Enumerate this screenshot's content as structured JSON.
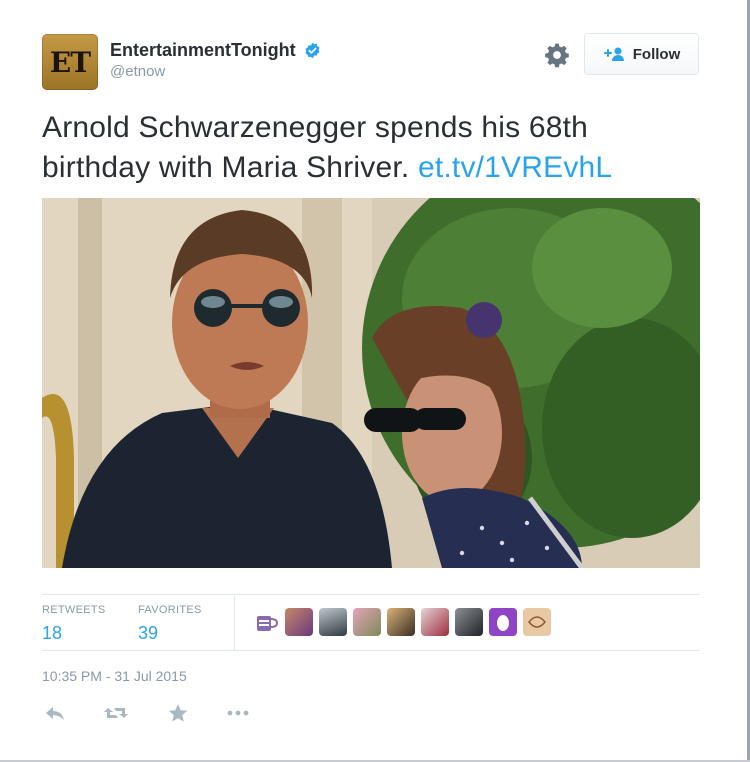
{
  "user": {
    "avatar_text": "ET",
    "fullname": "EntertainmentTonight",
    "handle": "@etnow"
  },
  "follow_button": {
    "label": "Follow"
  },
  "tweet": {
    "text": "Arnold Schwarzenegger spends his 68th birthday with Maria Shriver.",
    "link": "et.tv/1VREvhL"
  },
  "stats": {
    "retweets_label": "RETWEETS",
    "retweets_value": "18",
    "favorites_label": "FAVORITES",
    "favorites_value": "39"
  },
  "timestamp": "10:35 PM - 31 Jul 2015",
  "colors": {
    "link": "#2aa3ef",
    "verified": "#2aa3ef",
    "muted": "#8899a6"
  }
}
